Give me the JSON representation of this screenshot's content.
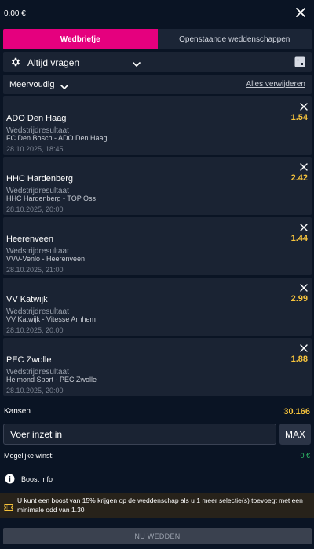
{
  "header": {
    "balance": "0.00 €",
    "close_icon": "close-icon"
  },
  "tabs": [
    {
      "label": "Wedbriefje",
      "active": true
    },
    {
      "label": "Openstaande weddenschappen",
      "active": false
    }
  ],
  "settings": {
    "label": "Altijd vragen",
    "icon": "gear-icon"
  },
  "betslip": {
    "mode": "Meervoudig",
    "remove_all": "Alles verwijderen",
    "selections": [
      {
        "team": "ADO Den Haag",
        "odd": "1.54",
        "market": "Wedstrijdresultaat",
        "match": "FC Den Bosch - ADO Den Haag",
        "date": "28.10.2025, 18:45"
      },
      {
        "team": "HHC Hardenberg",
        "odd": "2.42",
        "market": "Wedstrijdresultaat",
        "match": "HHC Hardenberg - TOP Oss",
        "date": "28.10.2025, 20:00"
      },
      {
        "team": "Heerenveen",
        "odd": "1.44",
        "market": "Wedstrijdresultaat",
        "match": "VVV-Venlo - Heerenveen",
        "date": "28.10.2025, 21:00"
      },
      {
        "team": "VV Katwijk",
        "odd": "2.99",
        "market": "Wedstrijdresultaat",
        "match": "VV Katwijk - Vitesse Arnhem",
        "date": "28.10.2025, 20:00"
      },
      {
        "team": "PEC Zwolle",
        "odd": "1.88",
        "market": "Wedstrijdresultaat",
        "match": "Helmond Sport - PEC Zwolle",
        "date": "28.10.2025, 20:00"
      }
    ]
  },
  "summary": {
    "odds_label": "Kansen",
    "odds_value": "30.166",
    "stake_placeholder": "Voer inzet in",
    "max_label": "MAX",
    "winst_label": "Mogelijke winst:",
    "winst_value": "0 €"
  },
  "boost": {
    "info_label": "Boost info",
    "banner_text": "U kunt een boost van 15% krijgen op de weddenschap als u 1 meer selectie(s) toevoegt met een minimale odd van 1.30"
  },
  "place_bet_label": "NU WEDDEN",
  "colors": {
    "accent": "#e5007e",
    "background": "#0a1424",
    "panel": "#1a2333",
    "odd": "#f6c33c",
    "win": "#31c46b"
  }
}
